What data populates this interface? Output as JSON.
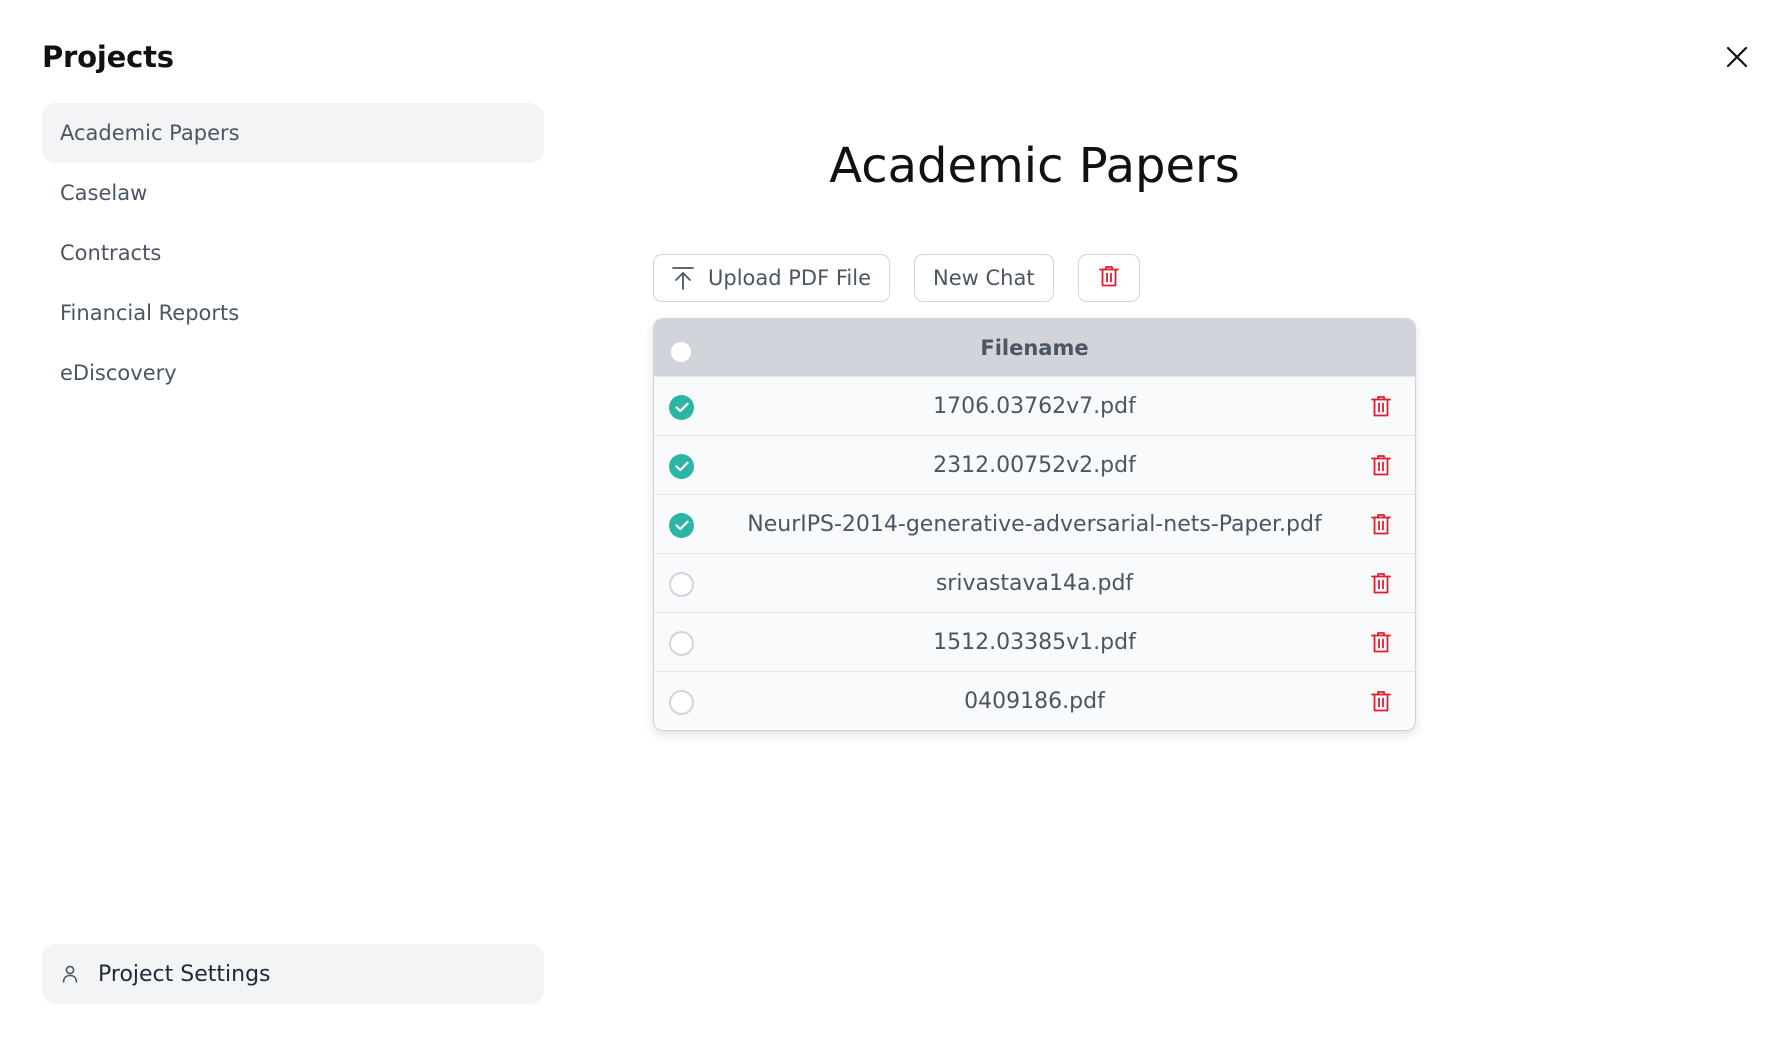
{
  "sidebar": {
    "title": "Projects",
    "items": [
      {
        "label": "Academic Papers",
        "active": true
      },
      {
        "label": "Caselaw",
        "active": false
      },
      {
        "label": "Contracts",
        "active": false
      },
      {
        "label": "Financial Reports",
        "active": false
      },
      {
        "label": "eDiscovery",
        "active": false
      }
    ],
    "settings_label": "Project Settings",
    "settings_icon": "user-icon"
  },
  "header": {
    "close_icon": "close-icon"
  },
  "main": {
    "title": "Academic Papers",
    "toolbar": {
      "upload_label": "Upload PDF File",
      "upload_icon": "upload-arrow-icon",
      "new_chat_label": "New Chat",
      "delete_icon": "trash-icon"
    },
    "table": {
      "column_header": "Filename",
      "rows": [
        {
          "filename": "1706.03762v7.pdf",
          "selected": true
        },
        {
          "filename": "2312.00752v2.pdf",
          "selected": true
        },
        {
          "filename": "NeurIPS-2014-generative-adversarial-nets-Paper.pdf",
          "selected": true
        },
        {
          "filename": "srivastava14a.pdf",
          "selected": false
        },
        {
          "filename": "1512.03385v1.pdf",
          "selected": false
        },
        {
          "filename": "0409186.pdf",
          "selected": false
        }
      ]
    }
  },
  "colors": {
    "accent": "#2bb5a4",
    "danger": "#e11d2e",
    "active_bg": "#f3f4f6",
    "header_bg": "#d1d5db"
  }
}
